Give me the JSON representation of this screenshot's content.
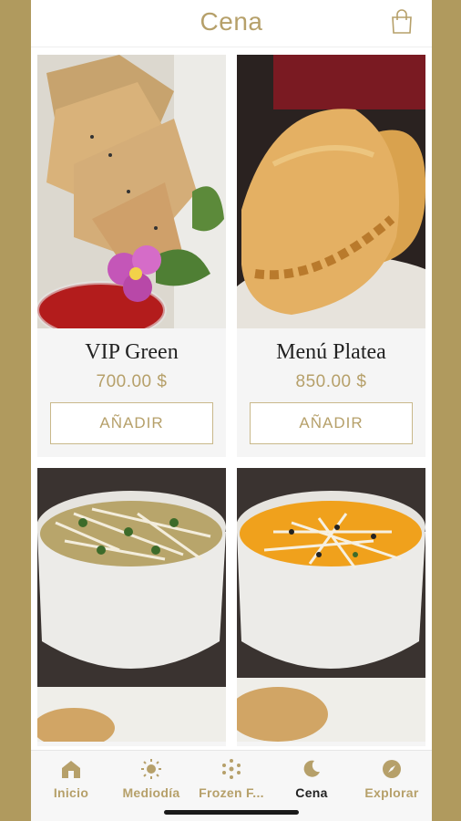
{
  "header": {
    "title": "Cena",
    "bag_icon": "shopping-bag-icon"
  },
  "products": [
    {
      "name": "VIP Green",
      "price": "700.00 $",
      "add_label": "AÑADIR"
    },
    {
      "name": "Menú Platea",
      "price": "850.00 $",
      "add_label": "AÑADIR"
    }
  ],
  "tabs": [
    {
      "label": "Inicio",
      "icon": "home-icon"
    },
    {
      "label": "Mediodía",
      "icon": "sun-icon"
    },
    {
      "label": "Frozen F...",
      "icon": "snowflake-icon"
    },
    {
      "label": "Cena",
      "icon": "moon-icon",
      "active": true
    },
    {
      "label": "Explorar",
      "icon": "compass-icon"
    }
  ],
  "colors": {
    "accent": "#b6a06a",
    "frame": "#b09a5e",
    "card": "#f5f5f5"
  }
}
